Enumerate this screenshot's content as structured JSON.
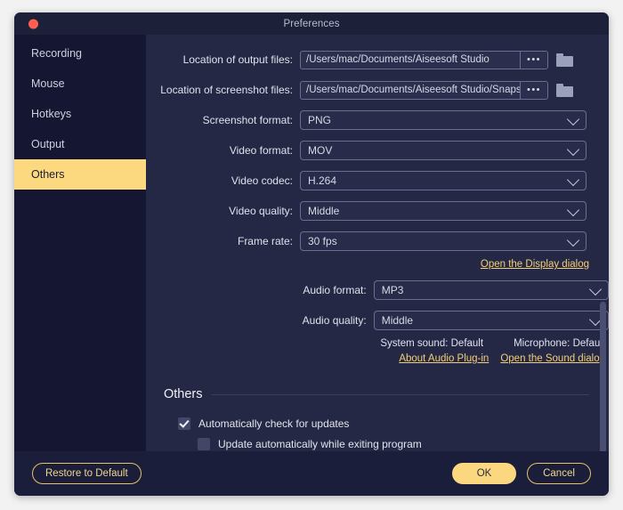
{
  "window": {
    "title": "Preferences",
    "close_icon": "close-dot-icon"
  },
  "sidebar": {
    "items": [
      {
        "label": "Recording",
        "active": false
      },
      {
        "label": "Mouse",
        "active": false
      },
      {
        "label": "Hotkeys",
        "active": false
      },
      {
        "label": "Output",
        "active": false
      },
      {
        "label": "Others",
        "active": true
      }
    ]
  },
  "form": {
    "output_location": {
      "label": "Location of output files:",
      "value": "/Users/mac/Documents/Aiseesoft Studio",
      "browse_label": "•••",
      "folder_icon": "folder-icon"
    },
    "screenshot_location": {
      "label": "Location of screenshot files:",
      "value": "/Users/mac/Documents/Aiseesoft Studio/Snapshot",
      "browse_label": "•••",
      "folder_icon": "folder-icon"
    },
    "screenshot_format": {
      "label": "Screenshot format:",
      "value": "PNG"
    },
    "video_format": {
      "label": "Video format:",
      "value": "MOV"
    },
    "video_codec": {
      "label": "Video codec:",
      "value": "H.264"
    },
    "video_quality": {
      "label": "Video quality:",
      "value": "Middle"
    },
    "frame_rate": {
      "label": "Frame rate:",
      "value": "30 fps"
    },
    "display_dialog_link": "Open the Display dialog",
    "audio_format": {
      "label": "Audio format:",
      "value": "MP3"
    },
    "audio_quality": {
      "label": "Audio quality:",
      "value": "Middle"
    },
    "system_sound": {
      "label": "System sound:",
      "value": "Default"
    },
    "microphone": {
      "label": "Microphone:",
      "value": "Default"
    },
    "about_audio_plugin_link": "About Audio Plug-in",
    "sound_dialog_link": "Open the Sound dialog"
  },
  "others_section": {
    "title": "Others",
    "auto_check_updates": {
      "label": "Automatically check for updates",
      "checked": true
    },
    "auto_update_exit": {
      "label": "Update automatically while exiting program",
      "checked": false
    }
  },
  "footer": {
    "restore_label": "Restore to Default",
    "ok_label": "OK",
    "cancel_label": "Cancel"
  },
  "colors": {
    "accent": "#fbd87f",
    "link": "#f2cf78",
    "window_bg": "#252845",
    "sidebar_bg": "#151732",
    "titlebar_bg": "#1d2039",
    "footer_bg": "#1b1e3a",
    "close_button": "#ff5f52"
  }
}
